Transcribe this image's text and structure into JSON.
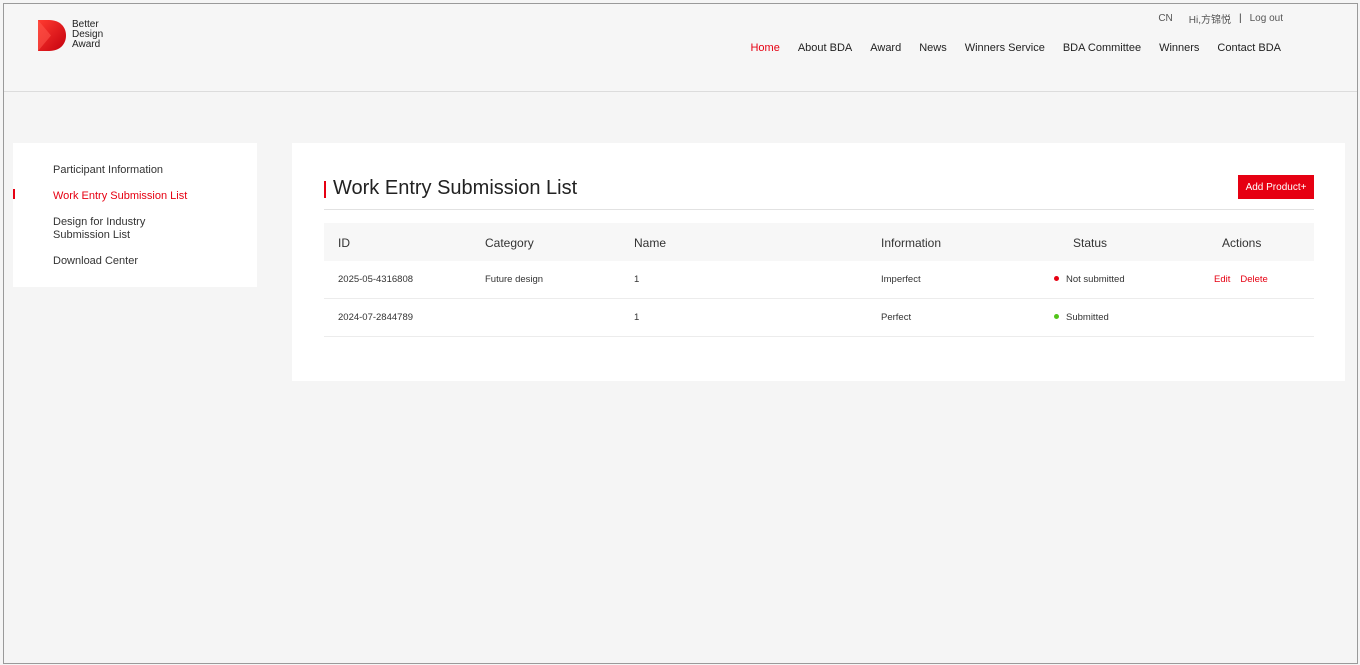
{
  "brand": {
    "logo_lines": [
      "Better",
      "Design",
      "Award"
    ],
    "accent": "#e60012"
  },
  "topbar": {
    "lang": "CN",
    "greeting": "Hi,方锦悦",
    "separator": "|",
    "logout": "Log out"
  },
  "nav": [
    {
      "label": "Home",
      "active": true
    },
    {
      "label": "About BDA",
      "active": false
    },
    {
      "label": "Award",
      "active": false
    },
    {
      "label": "News",
      "active": false
    },
    {
      "label": "Winners Service",
      "active": false
    },
    {
      "label": "BDA Committee",
      "active": false
    },
    {
      "label": "Winners",
      "active": false
    },
    {
      "label": "Contact BDA",
      "active": false
    }
  ],
  "sidebar": {
    "items": [
      {
        "label": "Participant Information"
      },
      {
        "label": "Work Entry Submission List",
        "active": true
      },
      {
        "label": "Design for Industry\nSubmission List"
      },
      {
        "label": "Download Center"
      }
    ]
  },
  "main": {
    "title": "Work Entry Submission List",
    "add_button": "Add Product+",
    "columns": [
      "ID",
      "Category",
      "Name",
      "Information",
      "Status",
      "Actions"
    ],
    "rows": [
      {
        "id": "2025-05-4316808",
        "category": "Future design",
        "name": "1",
        "information": "Imperfect",
        "status": "Not submitted",
        "status_color": "#e60012",
        "actions": [
          "Edit",
          "Delete"
        ]
      },
      {
        "id": "2024-07-2844789",
        "category": "",
        "name": "1",
        "information": "Perfect",
        "status": "Submitted",
        "status_color": "#52c41a",
        "actions": []
      }
    ]
  }
}
